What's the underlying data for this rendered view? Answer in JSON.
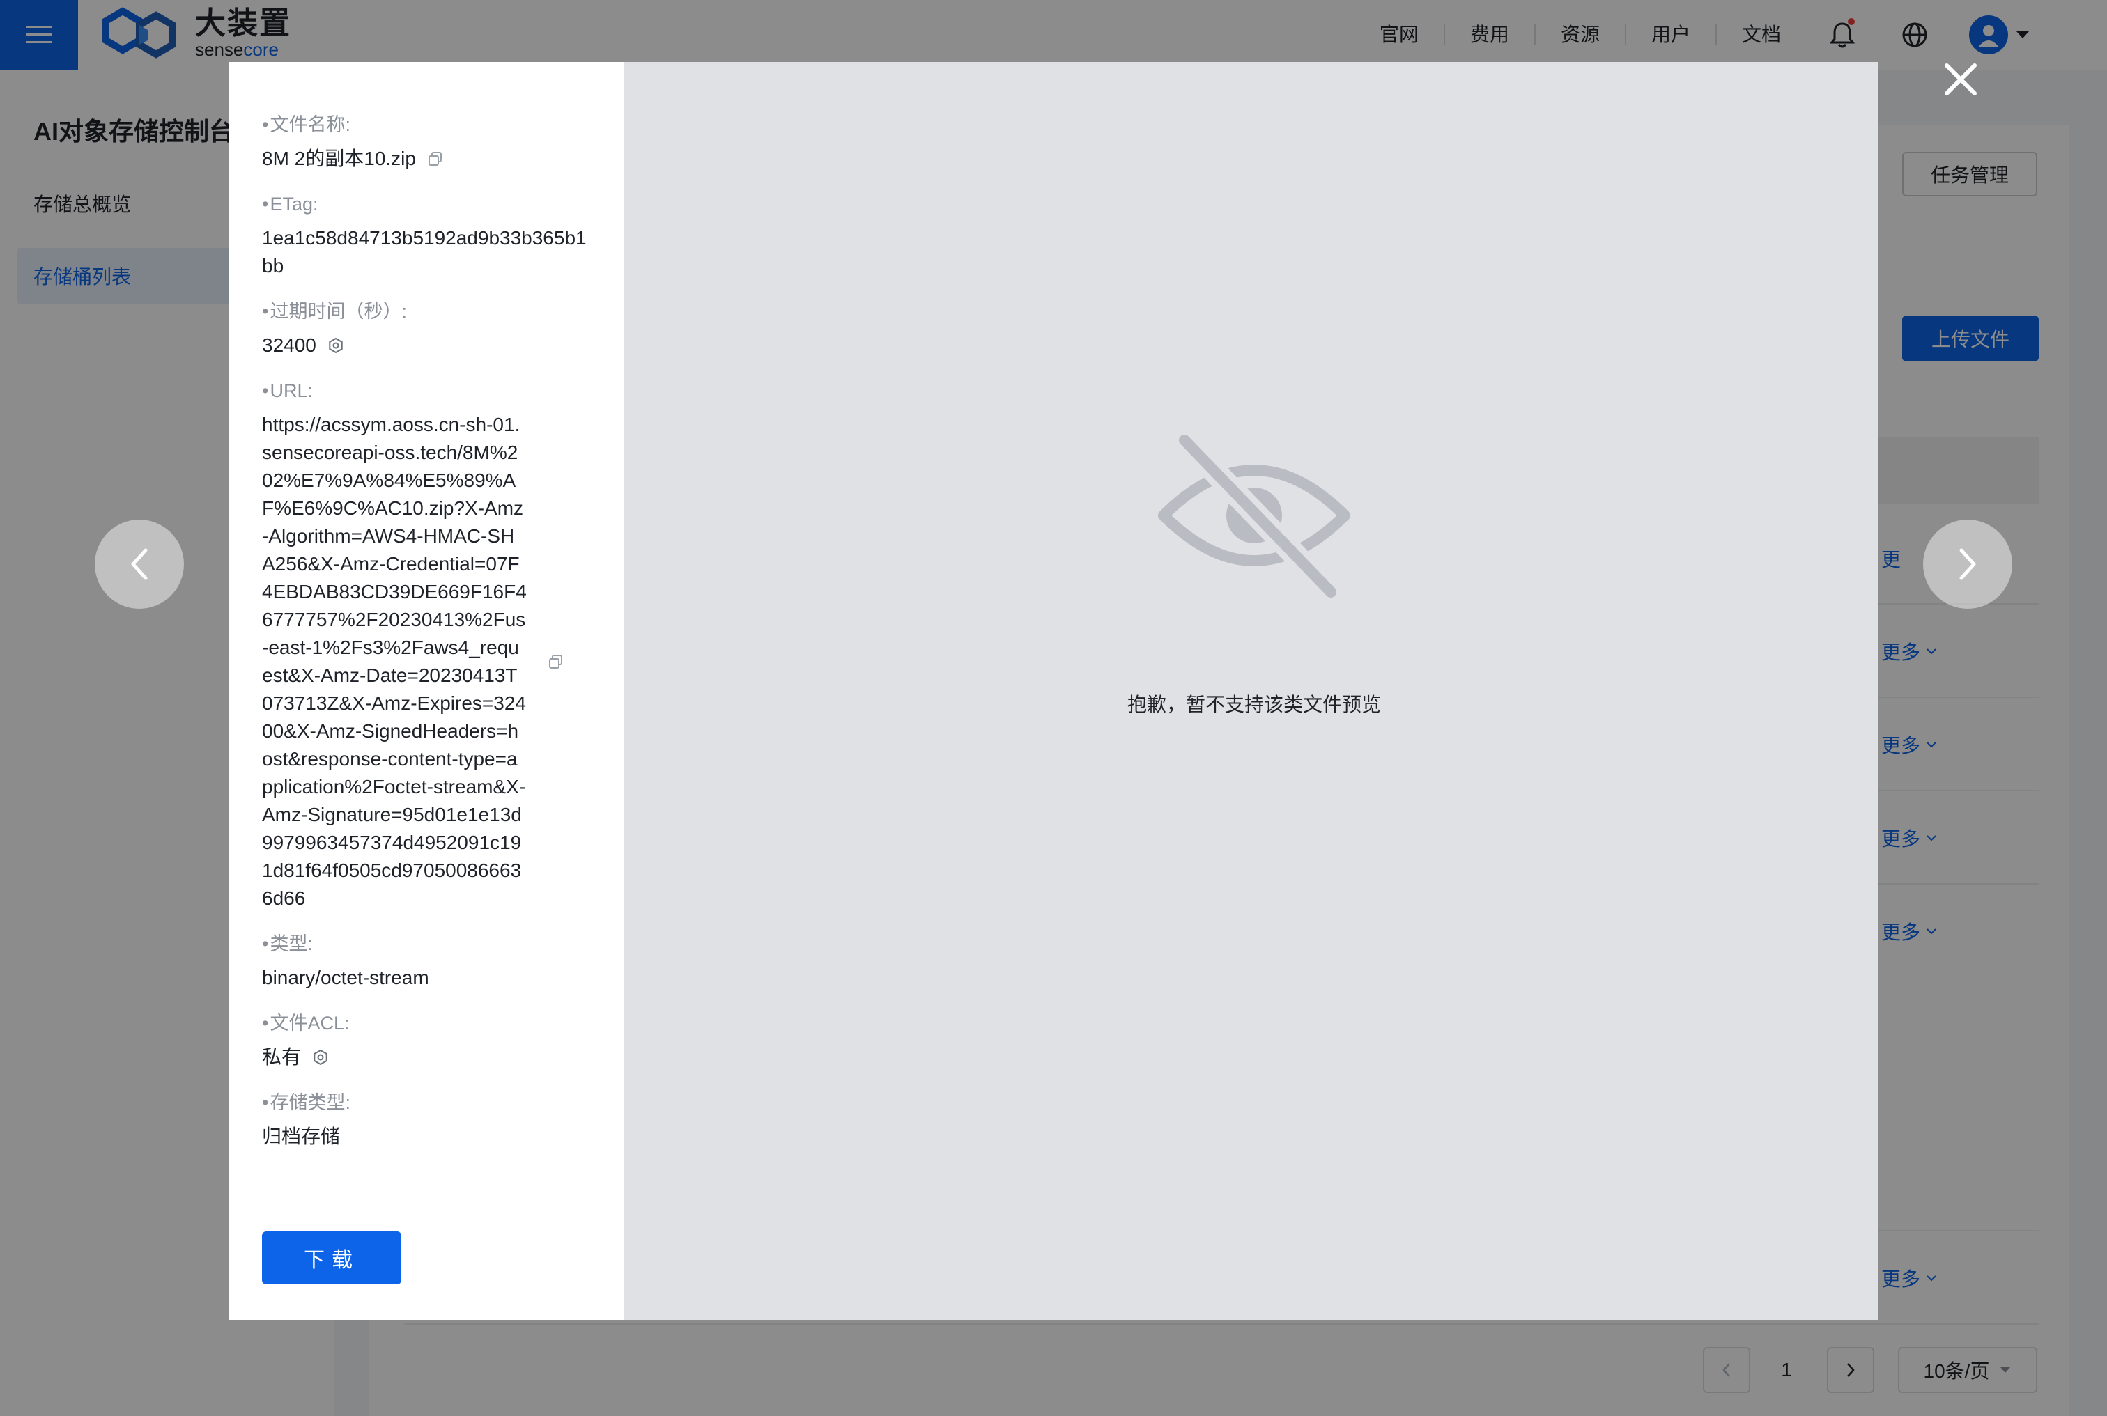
{
  "header": {
    "logo_cn": "大装置",
    "logo_en_a": "sense",
    "logo_en_b": "core",
    "nav": [
      "官网",
      "费用",
      "资源",
      "用户",
      "文档"
    ]
  },
  "sidebar": {
    "title": "AI对象存储控制台",
    "items": [
      {
        "label": "存储总概览",
        "active": false
      },
      {
        "label": "存储桶列表",
        "active": true
      }
    ]
  },
  "main": {
    "task_button": "任务管理",
    "upload_button": "上传文件",
    "row_action": "更多",
    "row_action_first": "更",
    "pagination": {
      "page": "1",
      "page_size": "10条/页"
    }
  },
  "detail": {
    "file_name_label": "文件名称:",
    "file_name": "8M 2的副本10.zip",
    "etag_label": "ETag:",
    "etag": "1ea1c58d84713b5192ad9b33b365b1bb",
    "expire_label": "过期时间（秒）:",
    "expire": "32400",
    "url_label": "URL:",
    "url": "https://acssym.aoss.cn-sh-01.sensecoreapi-oss.tech/8M%202%E7%9A%84%E5%89%AF%E6%9C%AC10.zip?X-Amz-Algorithm=AWS4-HMAC-SHA256&X-Amz-Credential=07F4EBDAB83CD39DE669F16F46777757%2F20230413%2Fus-east-1%2Fs3%2Faws4_request&X-Amz-Date=20230413T073713Z&X-Amz-Expires=32400&X-Amz-SignedHeaders=host&response-content-type=application%2Foctet-stream&X-Amz-Signature=95d01e1e13d9979963457374d4952091c191d81f64f0505cd970500866636d66",
    "type_label": "类型:",
    "type": "binary/octet-stream",
    "acl_label": "文件ACL:",
    "acl": "私有",
    "storage_label": "存储类型:",
    "storage": "归档存储",
    "download_button": "下载"
  },
  "preview": {
    "message": "抱歉，暂不支持该类文件预览",
    "icon": "eye-off-icon"
  },
  "colors": {
    "primary": "#0d64e8",
    "mask": "rgba(0,0,0,0.45)",
    "preview_bg": "#dfe1e5"
  }
}
